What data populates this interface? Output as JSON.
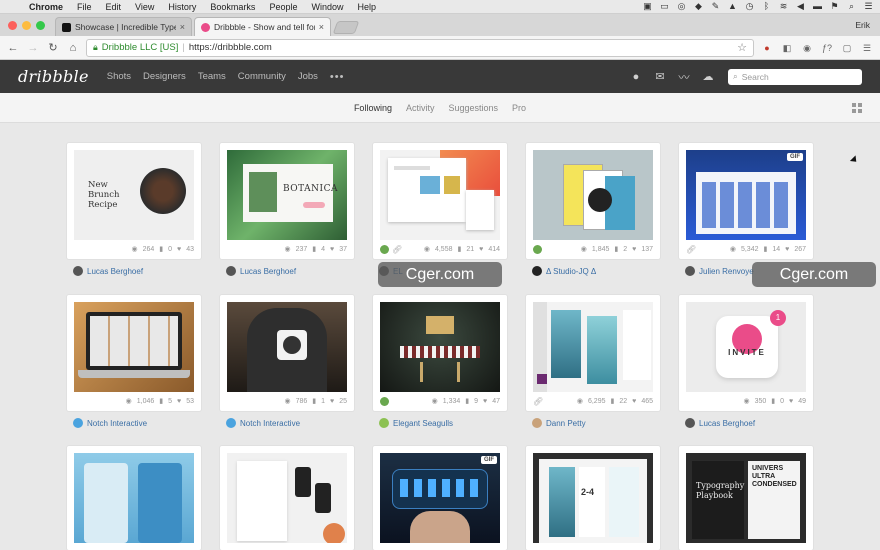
{
  "menubar": {
    "app": "Chrome",
    "items": [
      "File",
      "Edit",
      "View",
      "History",
      "Bookmarks",
      "People",
      "Window",
      "Help"
    ]
  },
  "tabs": [
    {
      "title": "Showcase | Incredible Types",
      "icon": "typewolf-favicon"
    },
    {
      "title": "Dribbble - Show and tell for de",
      "icon": "dribbble-favicon"
    }
  ],
  "user_name": "Erik",
  "address": {
    "org": "Dribbble LLC [US]",
    "url": "https://dribbble.com"
  },
  "nav": {
    "logo": "dribbble",
    "links": [
      "Shots",
      "Designers",
      "Teams",
      "Community",
      "Jobs"
    ],
    "more": "•••",
    "search_placeholder": "Search"
  },
  "subnav": [
    "Following",
    "Activity",
    "Suggestions",
    "Pro"
  ],
  "shots": [
    {
      "views": "264",
      "comments": "0",
      "likes": "43",
      "author": "Lucas Berghoef",
      "title": "New Brunch Recipe"
    },
    {
      "views": "237",
      "comments": "4",
      "likes": "37",
      "author": "Lucas Berghoef",
      "title": "BOTANICA"
    },
    {
      "views": "4,558",
      "comments": "21",
      "likes": "414",
      "author": "EL",
      "title": ""
    },
    {
      "views": "1,845",
      "comments": "2",
      "likes": "137",
      "author": "Δ Studio-JQ Δ",
      "title": ""
    },
    {
      "views": "5,342",
      "comments": "14",
      "likes": "267",
      "author": "Julien Renvoye",
      "title": ""
    },
    {
      "views": "1,046",
      "comments": "5",
      "likes": "53",
      "author": "Notch Interactive",
      "title": ""
    },
    {
      "views": "786",
      "comments": "1",
      "likes": "25",
      "author": "Notch Interactive",
      "title": ""
    },
    {
      "views": "1,334",
      "comments": "9",
      "likes": "47",
      "author": "Elegant Seagulls",
      "title": ""
    },
    {
      "views": "6,295",
      "comments": "22",
      "likes": "465",
      "author": "Dann Petty",
      "title": ""
    },
    {
      "views": "350",
      "comments": "0",
      "likes": "49",
      "author": "Lucas Berghoef",
      "title": "INVITE"
    }
  ],
  "invite_badge": "1",
  "gif_label": "GIF",
  "row3": [
    {
      "title": ""
    },
    {
      "title": ""
    },
    {
      "title": ""
    },
    {
      "title": "2-4"
    },
    {
      "title": "Typography Playbook",
      "title2": "UNIVERS ULTRA CONDENSED"
    }
  ],
  "watermark": "Cger.com",
  "colors": {
    "accent": "#ea4c89",
    "nav_bg": "#393939",
    "link": "#3a6ea5"
  }
}
